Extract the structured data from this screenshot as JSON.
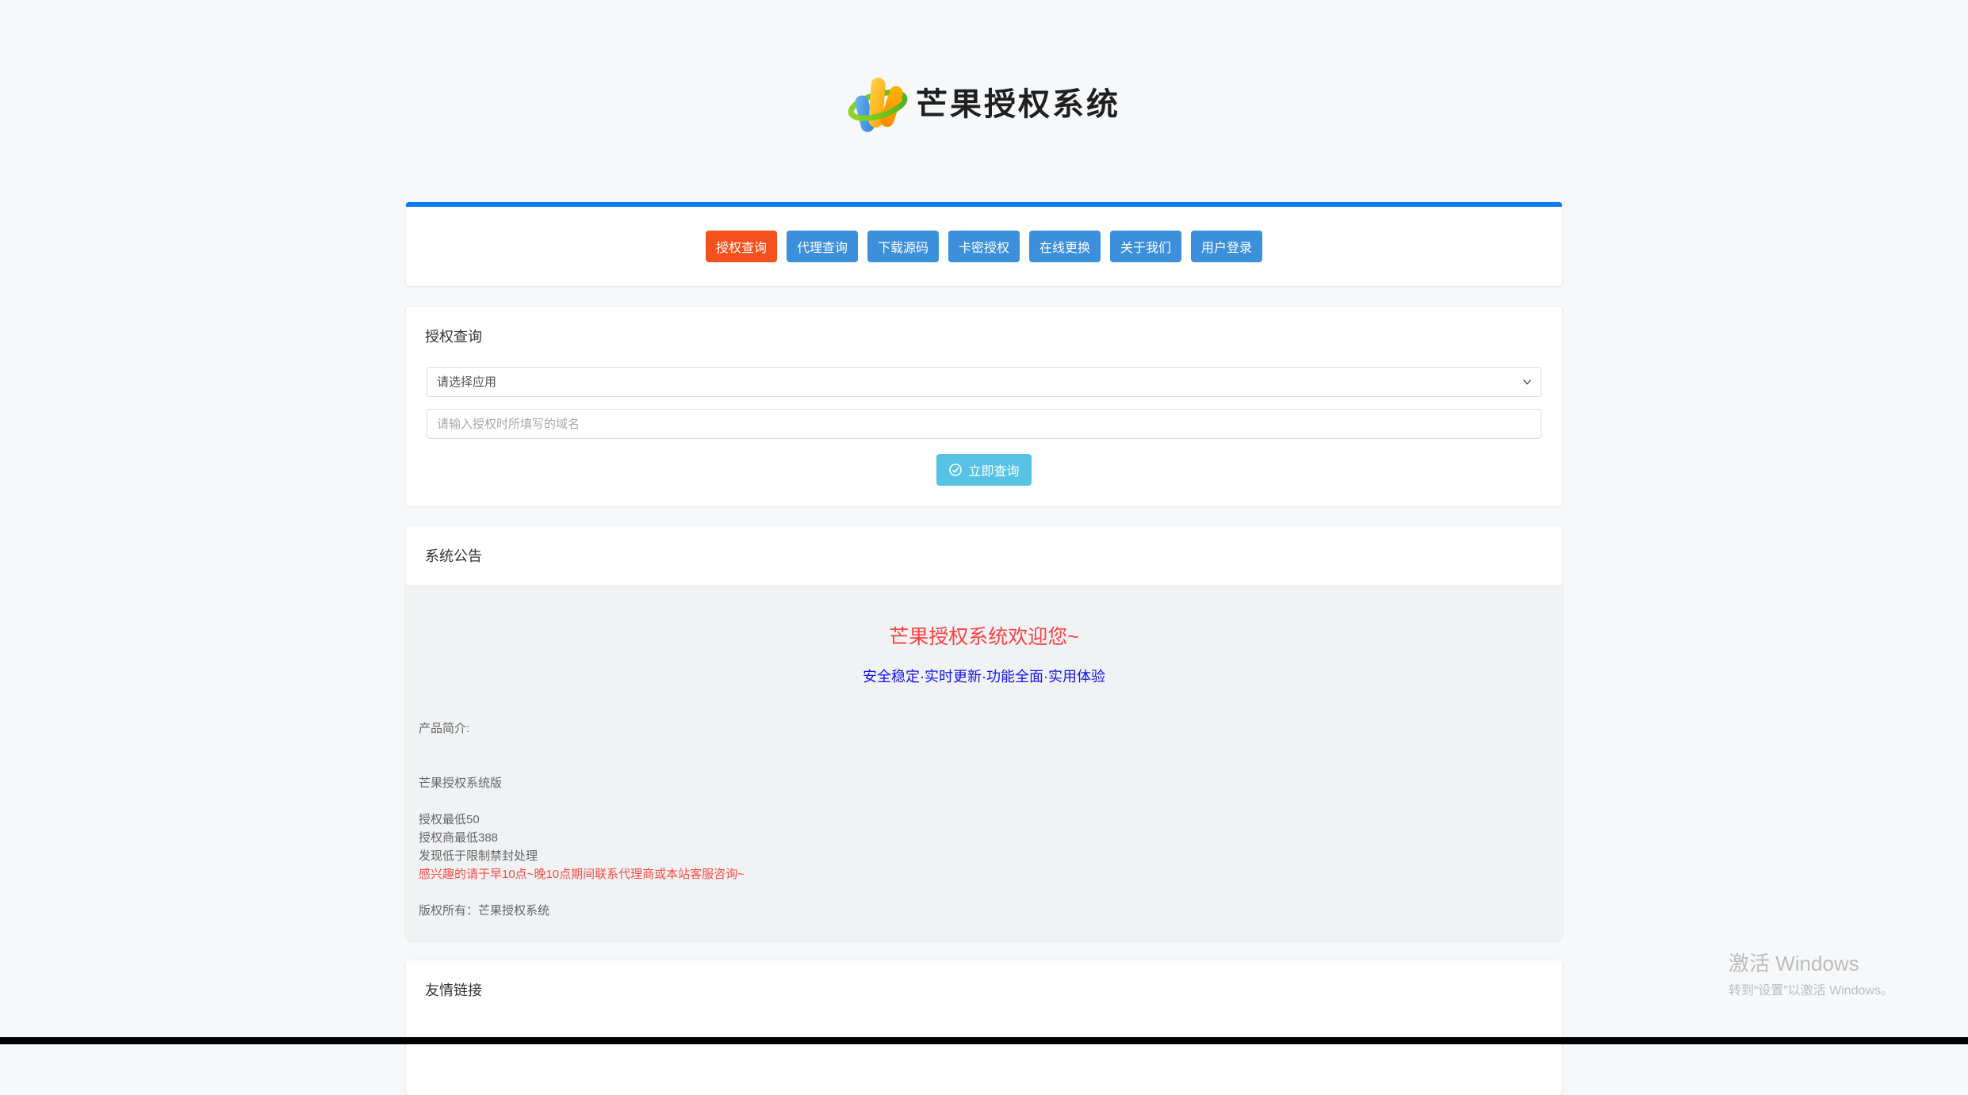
{
  "header": {
    "logo_text": "芒果授权系统",
    "logo_icon": "mango-m-logo"
  },
  "nav": {
    "accent_bar_color": "#0b7af5",
    "active_color": "#f4511e",
    "button_color": "#3c8fdb",
    "items": [
      {
        "label": "授权查询",
        "active": true
      },
      {
        "label": "代理查询",
        "active": false
      },
      {
        "label": "下载源码",
        "active": false
      },
      {
        "label": "卡密授权",
        "active": false
      },
      {
        "label": "在线更换",
        "active": false
      },
      {
        "label": "关于我们",
        "active": false
      },
      {
        "label": "用户登录",
        "active": false
      }
    ]
  },
  "query_card": {
    "title": "授权查询",
    "app_select": {
      "value": "请选择应用"
    },
    "domain_input": {
      "placeholder": "请输入授权时所填写的域名"
    },
    "submit": {
      "label": "立即查询",
      "icon": "check-circle-icon",
      "color": "#56c3e4"
    }
  },
  "announcement_card": {
    "title": "系统公告",
    "welcome": {
      "text": "芒果授权系统欢迎您~",
      "color": "#fb4343"
    },
    "subtitle": {
      "text": "安全稳定·实时更新·功能全面·实用体验",
      "color": "#1515ee"
    },
    "lines": [
      {
        "text": "产品简介:",
        "color": "#666666"
      },
      {
        "text": "",
        "color": "#666666"
      },
      {
        "text": "",
        "color": "#666666"
      },
      {
        "text": "芒果授权系统版",
        "color": "#666666"
      },
      {
        "text": "",
        "color": "#666666"
      },
      {
        "text": "授权最低50",
        "color": "#666666"
      },
      {
        "text": "授权商最低388",
        "color": "#666666"
      },
      {
        "text": "发现低于限制禁封处理",
        "color": "#666666"
      },
      {
        "text": "感兴趣的请于早10点~晚10点期间联系代理商或本站客服咨询~",
        "color": "#fa4b42"
      },
      {
        "text": "",
        "color": "#666666"
      },
      {
        "text": "版权所有：芒果授权系统",
        "color": "#666666"
      }
    ]
  },
  "links_card": {
    "title": "友情链接"
  },
  "watermark": {
    "title": "激活 Windows",
    "subtitle": "转到“设置”以激活 Windows。"
  }
}
